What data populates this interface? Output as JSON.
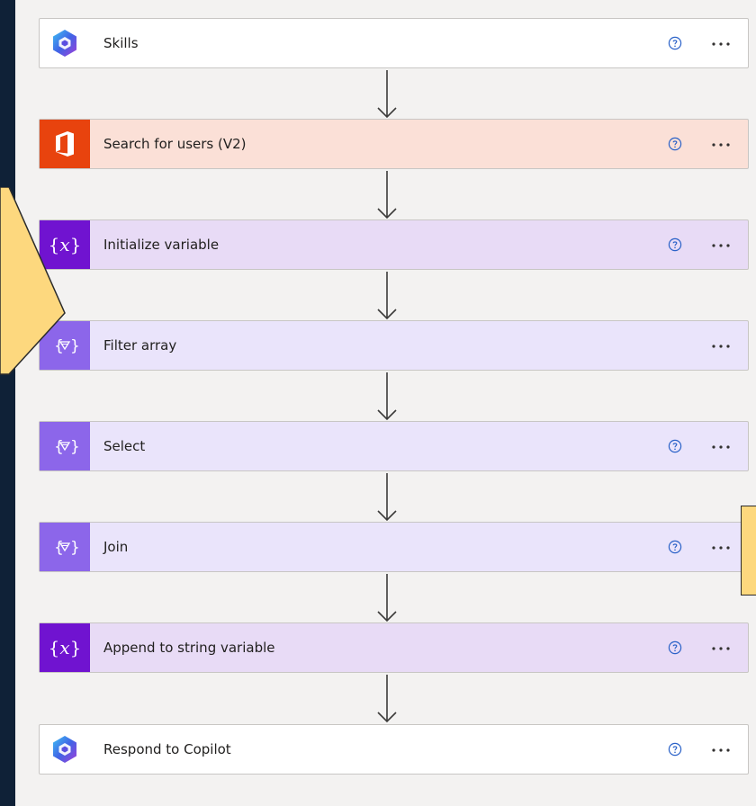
{
  "flow": {
    "steps": [
      {
        "label": "Skills",
        "variant": "white",
        "icon": "copilot-studio-icon",
        "has_help": true
      },
      {
        "label": "Search for users (V2)",
        "variant": "office",
        "icon": "office-365-icon",
        "has_help": true
      },
      {
        "label": "Initialize variable",
        "variant": "var",
        "icon": "variable-icon",
        "has_help": true
      },
      {
        "label": "Filter array",
        "variant": "data",
        "icon": "data-operation-icon",
        "has_help": false
      },
      {
        "label": "Select",
        "variant": "data",
        "icon": "data-operation-icon",
        "has_help": true
      },
      {
        "label": "Join",
        "variant": "data",
        "icon": "data-operation-icon",
        "has_help": true
      },
      {
        "label": "Append to string variable",
        "variant": "var",
        "icon": "variable-icon",
        "has_help": true
      },
      {
        "label": "Respond to Copilot",
        "variant": "white",
        "icon": "copilot-studio-icon",
        "has_help": true
      }
    ],
    "help_icon": "question-circle-icon",
    "more_icon": "ellipsis-icon",
    "connector_icon": "down-arrow-icon"
  },
  "colors": {
    "frame": "#0f2137",
    "canvas": "#f3f2f1",
    "office": "#e8430e",
    "variable": "#7013d0",
    "data_operation": "#8c66ea",
    "callout": "#fdd87e"
  }
}
